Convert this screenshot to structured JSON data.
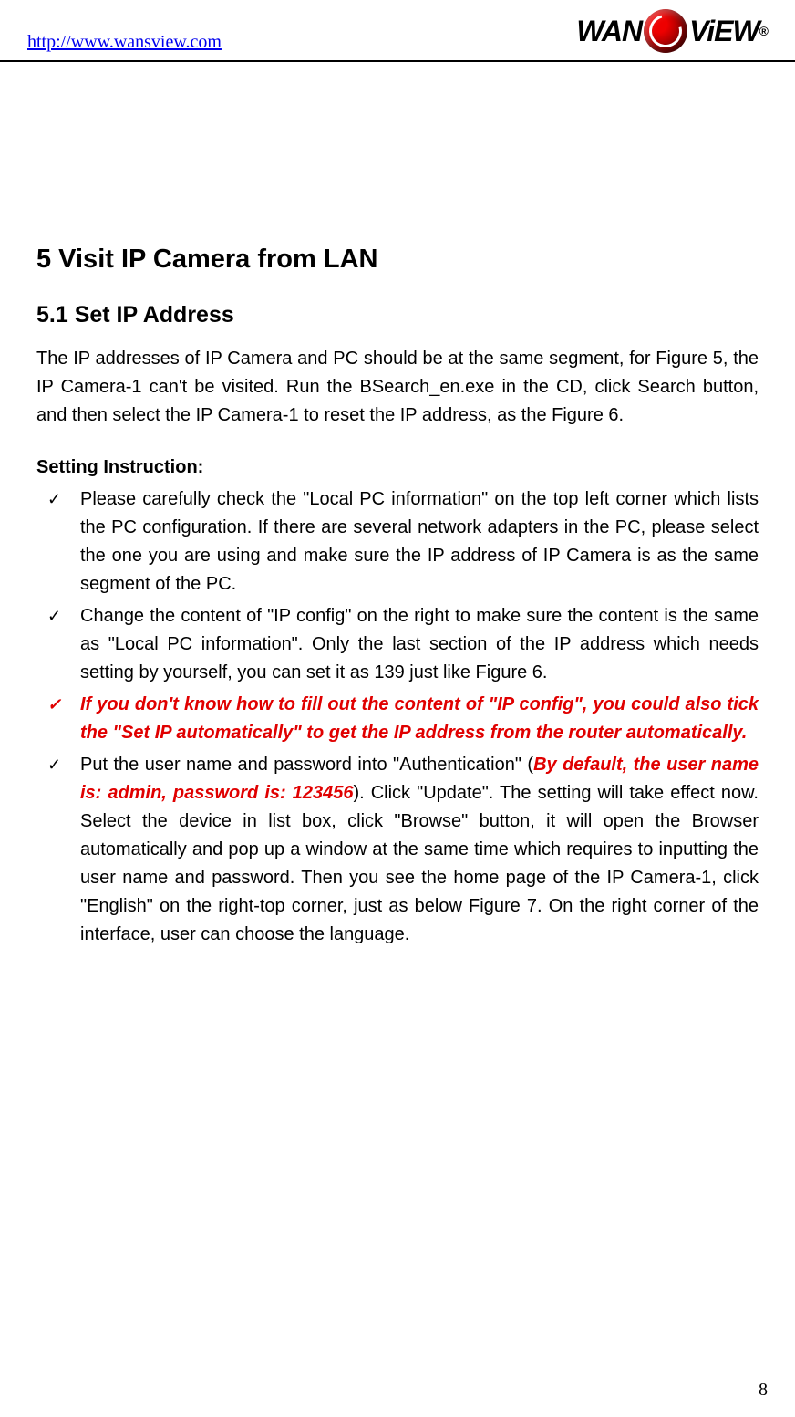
{
  "header": {
    "url": "http://www.wansview.com",
    "logo_text_1": "WAN",
    "logo_text_2": "ViEW",
    "logo_reg": "®"
  },
  "h1": "5  Visit IP Camera from LAN",
  "h2": "5.1  Set IP Address",
  "intro": "The IP addresses of IP Camera and PC should be at the same segment, for Figure 5, the IP Camera-1 can't be visited. Run the BSearch_en.exe in the CD, click Search button, and then select the IP Camera-1 to reset the IP address, as the Figure 6.",
  "setting_label": "Setting Instruction:",
  "items": {
    "0": "Please carefully check the \"Local PC information\" on the top left corner which lists the PC configuration. If there are several network adapters in the PC, please select the one you are using and make sure the IP address of IP Camera is as the same segment of the PC.",
    "1": "Change the content of \"IP config\" on the right to make sure the content is the same as \"Local PC information\". Only the last section of the IP address which needs setting by yourself, you can set it as 139 just like Figure 6.",
    "2": "If you don't know how to fill out the content of \"IP config\", you could also tick the \"Set IP automatically\" to get the IP address from the router automatically.",
    "3_pre": "Put the user name and password into \"Authentication\" (",
    "3_red": "By default, the user name is: admin, password is: 123456",
    "3_post": "). Click \"Update\". The setting will take effect now. Select the device in list box, click \"Browse\" button, it will open the Browser automatically and pop up a window at the same time which requires to inputting the user name and password. Then you see the home page of the IP Camera-1, click \"English\" on the right-top corner, just as below Figure 7. On the right corner of the interface, user can choose the language."
  },
  "page_number": "8"
}
